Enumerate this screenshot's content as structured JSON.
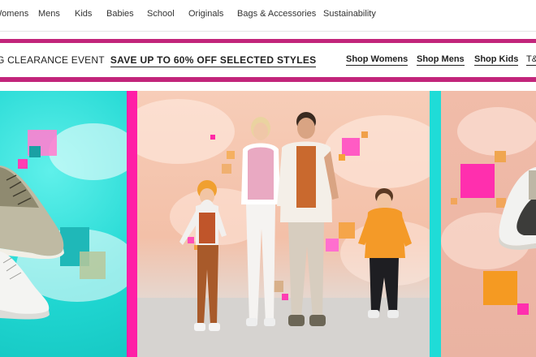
{
  "topnav": {
    "items": [
      "Womens",
      "Mens",
      "Kids",
      "Babies",
      "School",
      "Originals",
      "Bags & Accessories",
      "Sustainability"
    ]
  },
  "promo": {
    "event_text": "G CLEARANCE EVENT",
    "headline": "SAVE UP TO 60% OFF SELECTED STYLES",
    "links": [
      "Shop Womens",
      "Shop Mens",
      "Shop Kids",
      "T&"
    ]
  },
  "colors": {
    "stripe": "#c2257b",
    "hero_left": "#21d8d3",
    "hero_mid": "#f3c0a8",
    "hero_right": "#eab3a2",
    "separator_pink": "#ff1fa6",
    "separator_cyan": "#1fdcd7"
  },
  "hero": {
    "left_image": "sneakers-on-cyan",
    "middle_image": "family-photo-on-peach",
    "right_image": "sneakers-on-peach"
  }
}
